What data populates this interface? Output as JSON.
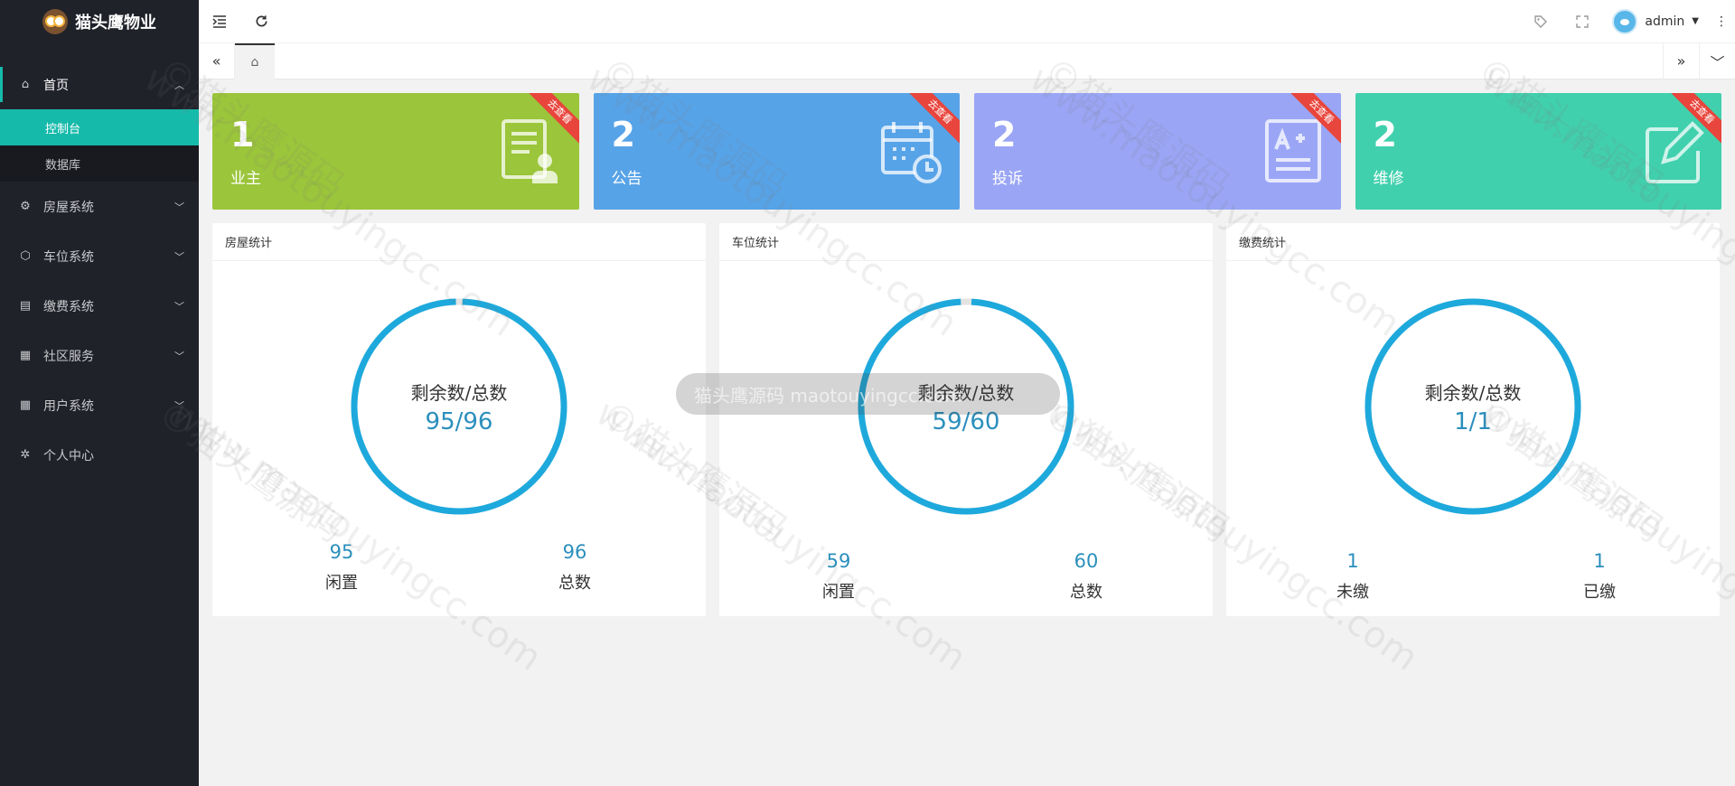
{
  "brand": {
    "title": "猫头鹰物业"
  },
  "sidebar": {
    "items": [
      {
        "label": "首页",
        "icon": "home-icon",
        "expanded": true,
        "children": [
          {
            "label": "控制台"
          },
          {
            "label": "数据库"
          }
        ]
      },
      {
        "label": "房屋系统",
        "icon": "gear-icon"
      },
      {
        "label": "车位系统",
        "icon": "cube-icon"
      },
      {
        "label": "缴费系统",
        "icon": "list-icon"
      },
      {
        "label": "社区服务",
        "icon": "apps-icon"
      },
      {
        "label": "用户系统",
        "icon": "apps-icon"
      },
      {
        "label": "个人中心",
        "icon": "settings-icon"
      }
    ]
  },
  "header": {
    "user_name": "admin"
  },
  "cards": [
    {
      "value": "1",
      "label": "业主",
      "ribbon": "去查看",
      "color": "#9bc53a"
    },
    {
      "value": "2",
      "label": "公告",
      "ribbon": "去查看",
      "color": "#57a3e8"
    },
    {
      "value": "2",
      "label": "投诉",
      "ribbon": "去查看",
      "color": "#9aa6f5"
    },
    {
      "value": "2",
      "label": "维修",
      "ribbon": "去查看",
      "color": "#41d0ad"
    }
  ],
  "panels": [
    {
      "title": "房屋统计",
      "ring_label": "剩余数/总数",
      "ring_value": "95/96",
      "remaining": 95,
      "total": 96,
      "stats": [
        {
          "value": "95",
          "label": "闲置"
        },
        {
          "value": "96",
          "label": "总数"
        }
      ]
    },
    {
      "title": "车位统计",
      "ring_label": "剩余数/总数",
      "ring_value": "59/60",
      "remaining": 59,
      "total": 60,
      "stats": [
        {
          "value": "59",
          "label": "闲置"
        },
        {
          "value": "60",
          "label": "总数"
        }
      ]
    },
    {
      "title": "缴费统计",
      "ring_label": "剩余数/总数",
      "ring_value": "1/1",
      "remaining": 1,
      "total": 1,
      "stats": [
        {
          "value": "1",
          "label": "未缴"
        },
        {
          "value": "1",
          "label": "已缴"
        }
      ]
    }
  ],
  "watermark": {
    "text_a": "©猫头鹰源码",
    "text_b": "www.maotouyingcc.com"
  },
  "toast": {
    "text": "猫头鹰源码 maotouyingcc.com"
  },
  "colors": {
    "accent": "#16baaa",
    "ring": "#1ea9dc",
    "sidebar_bg": "#20222a"
  }
}
